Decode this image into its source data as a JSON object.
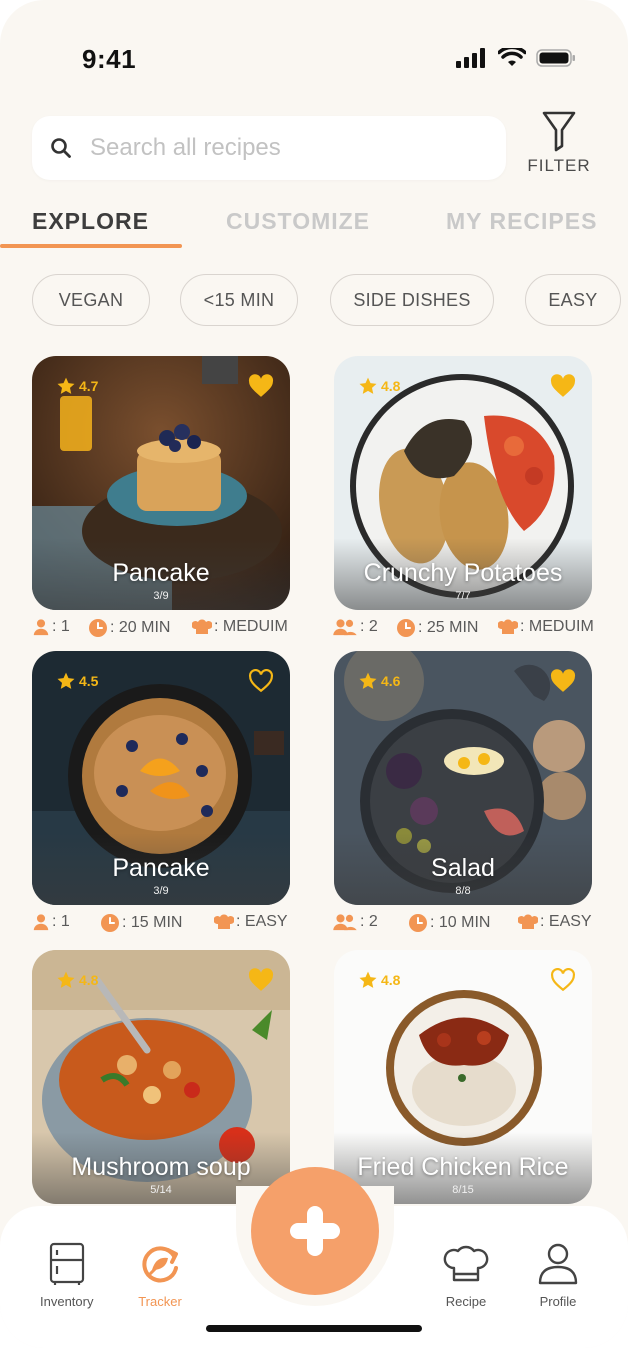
{
  "status_bar": {
    "time": "9:41",
    "icons": [
      "signal-icon",
      "wifi-icon",
      "battery-icon"
    ]
  },
  "search": {
    "placeholder": "Search all recipes",
    "value": ""
  },
  "filter": {
    "label": "FILTER",
    "icon": "funnel-icon"
  },
  "tabs": [
    {
      "label": "EXPLORE",
      "active": true
    },
    {
      "label": "CUSTOMIZE",
      "active": false
    },
    {
      "label": "MY RECIPES",
      "active": false
    }
  ],
  "chips": [
    "VEGAN",
    "<15 MIN",
    "SIDE DISHES",
    "EASY"
  ],
  "recipes": [
    {
      "name": "Pancake",
      "rating": "4.7",
      "steps": "3/9",
      "favorite": true,
      "people": ": 1",
      "time": ": 20 MIN",
      "difficulty": ": MEDUIM"
    },
    {
      "name": "Crunchy Potatoes",
      "rating": "4.8",
      "steps": "7/7",
      "favorite": true,
      "people": ": 2",
      "time": ": 25 MIN",
      "difficulty": ": MEDUIM"
    },
    {
      "name": "Pancake",
      "rating": "4.5",
      "steps": "3/9",
      "favorite": false,
      "people": ": 1",
      "time": ": 15 MIN",
      "difficulty": ": EASY"
    },
    {
      "name": "Salad",
      "rating": "4.6",
      "steps": "8/8",
      "favorite": true,
      "people": ": 2",
      "time": ": 10 MIN",
      "difficulty": ": EASY"
    },
    {
      "name": "Mushroom soup",
      "rating": "4.8",
      "steps": "5/14",
      "favorite": true
    },
    {
      "name": "Fried Chicken Rice",
      "rating": "4.8",
      "steps": "8/15",
      "favorite": false
    }
  ],
  "bottom_nav": [
    {
      "label": "Inventory",
      "icon": "fridge-icon",
      "active": false
    },
    {
      "label": "Tracker",
      "icon": "tracker-icon",
      "active": true
    },
    {
      "label": "Recipe",
      "icon": "chef-hat-icon",
      "active": false
    },
    {
      "label": "Profile",
      "icon": "user-icon",
      "active": false
    }
  ],
  "colors": {
    "accent": "#f29553",
    "star": "#f5b716",
    "background": "#faf7f2",
    "fab": "#f5a06a"
  }
}
